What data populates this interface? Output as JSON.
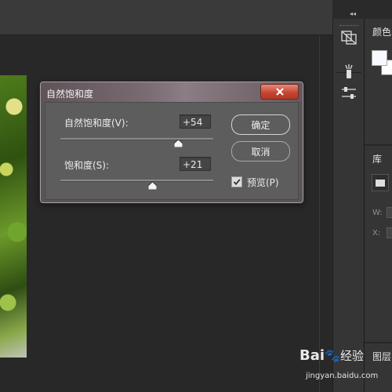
{
  "dialog": {
    "title": "自然饱和度",
    "vibrance": {
      "label": "自然饱和度(V):",
      "value": "+54",
      "level": 0.77
    },
    "saturation": {
      "label": "饱和度(S):",
      "value": "+21",
      "level": 0.605
    },
    "ok_label": "确定",
    "cancel_label": "取消",
    "preview": {
      "label": "预览(P)",
      "checked": true
    }
  },
  "panels": {
    "color_title": "颜色",
    "library_title": "库",
    "library_w_label": "W:",
    "library_x_label": "X:",
    "layers_title": "图层"
  },
  "watermark": {
    "logo": "Bai",
    "logo_suffix": "经验",
    "url": "jingyan.baidu.com"
  },
  "colors": {
    "close_button": "#c5432f",
    "foreground_swatch": "#f7f9ff",
    "background": "#262626"
  }
}
